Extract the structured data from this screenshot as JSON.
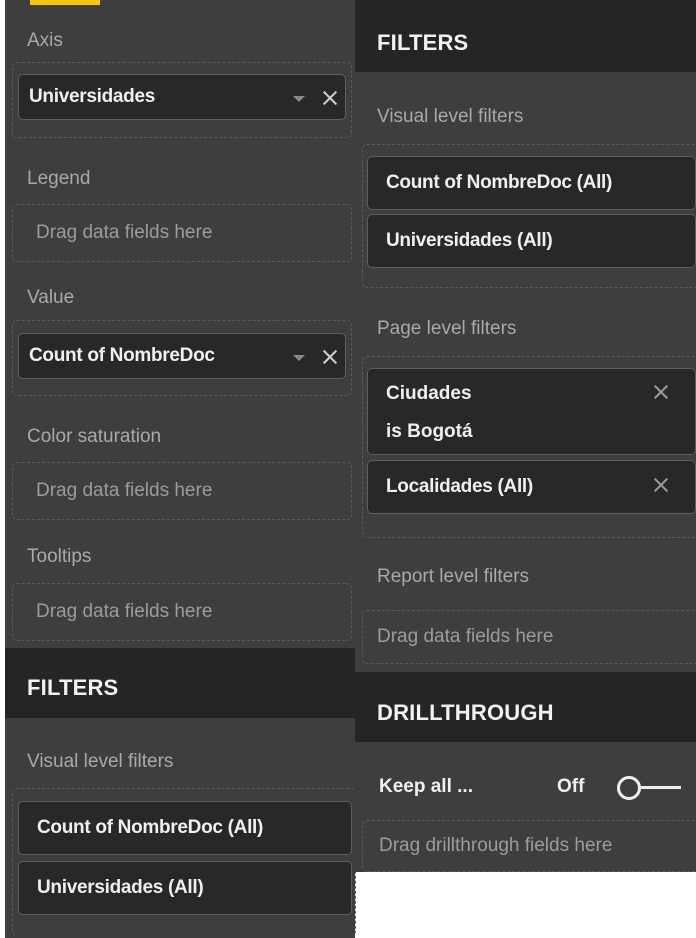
{
  "left": {
    "fields": {
      "axis": {
        "label": "Axis",
        "field": "Universidades"
      },
      "legend": {
        "label": "Legend",
        "placeholder": "Drag data fields here"
      },
      "value": {
        "label": "Value",
        "field": "Count of NombreDoc"
      },
      "color_saturation": {
        "label": "Color saturation",
        "placeholder": "Drag data fields here"
      },
      "tooltips": {
        "label": "Tooltips",
        "placeholder": "Drag data fields here"
      }
    },
    "filters": {
      "title": "FILTERS",
      "visual_level_label": "Visual level filters",
      "visual_items": [
        "Count of NombreDoc (All)",
        "Universidades (All)"
      ]
    }
  },
  "right": {
    "filters": {
      "title": "FILTERS",
      "visual_level_label": "Visual level filters",
      "visual_items": [
        "Count of NombreDoc (All)",
        "Universidades (All)"
      ],
      "page_level_label": "Page level filters",
      "page_items": [
        {
          "line1": "Ciudades",
          "line2": "is Bogotá"
        },
        {
          "line1": "Localidades (All)"
        }
      ],
      "report_level_label": "Report level filters",
      "report_placeholder": "Drag data fields here"
    },
    "drillthrough": {
      "title": "DRILLTHROUGH",
      "keep_all_label": "Keep all ...",
      "toggle_state": "Off",
      "placeholder": "Drag drillthrough fields here"
    }
  },
  "colors": {
    "panel_bg": "#3e3e3e",
    "header_bg": "#252525",
    "pill_bg": "#282828",
    "accent_tab": "#f2c811"
  }
}
